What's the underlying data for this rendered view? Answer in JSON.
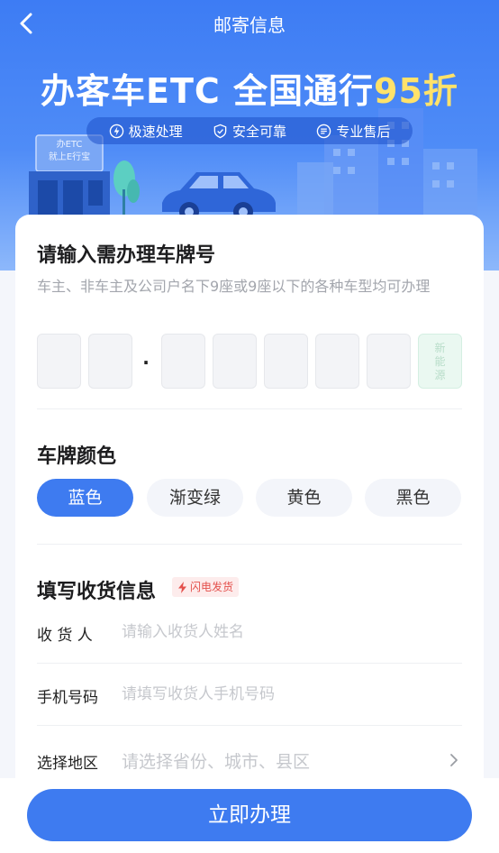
{
  "nav": {
    "title": "邮寄信息"
  },
  "banner": {
    "title_main": "办客车ETC 全国通行",
    "title_highlight": "95折",
    "sign_line1": "办ETC",
    "sign_line2": "就上E行宝",
    "features": [
      {
        "icon": "lightning-circle-icon",
        "label": "极速处理"
      },
      {
        "icon": "shield-check-icon",
        "label": "安全可靠"
      },
      {
        "icon": "after-sales-icon",
        "label": "专业售后"
      }
    ]
  },
  "plate_section": {
    "title": "请输入需办理车牌号",
    "hint": "车主、非车主及公司户名下9座或9座以下的各种车型均可办理",
    "separator": "·",
    "new_energy_label": "新能源"
  },
  "color_section": {
    "title": "车牌颜色",
    "options": [
      "蓝色",
      "渐变绿",
      "黄色",
      "黑色"
    ],
    "selected": "蓝色"
  },
  "shipping_section": {
    "title": "填写收货信息",
    "badge": "闪电发货",
    "fields": {
      "recipient": {
        "label": "收 货 人",
        "placeholder": "请输入收货人姓名"
      },
      "phone": {
        "label": "手机号码",
        "placeholder": "请填写收货人手机号码"
      },
      "region": {
        "label": "选择地区",
        "placeholder": "请选择省份、城市、县区"
      }
    }
  },
  "submit": {
    "label": "立即办理"
  },
  "colors": {
    "primary": "#3e7bf0",
    "highlight": "#ffe26a",
    "badge_red": "#e4504c"
  }
}
